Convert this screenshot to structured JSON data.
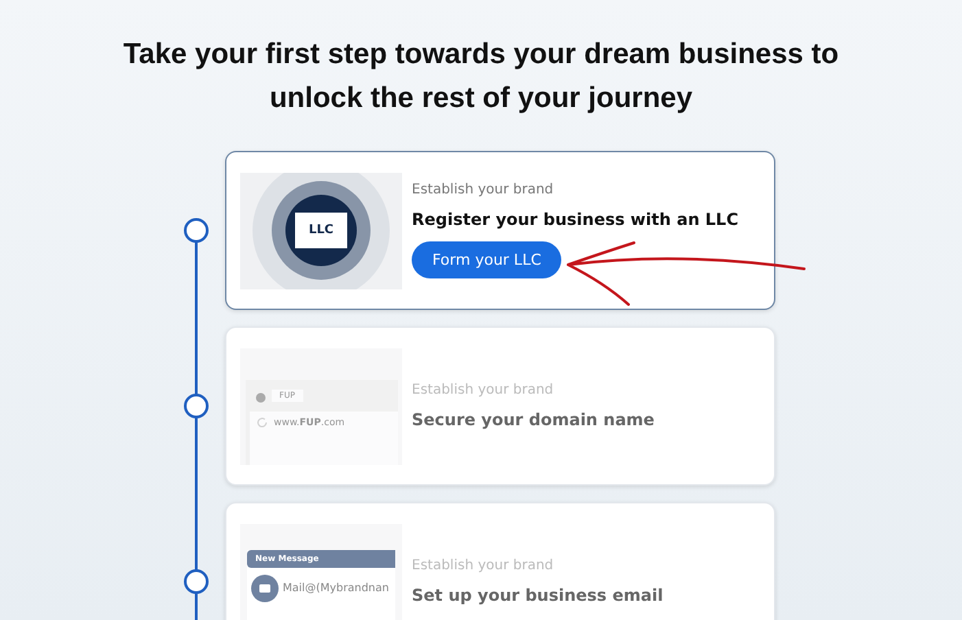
{
  "heading": "Take your first step towards your dream business to unlock the rest of your journey",
  "steps": [
    {
      "kind": "llc",
      "selected": true,
      "eyebrow": "Establish your brand",
      "title": "Register your business with an LLC",
      "art_label": "LLC",
      "button": "Form your LLC"
    },
    {
      "kind": "domain",
      "selected": false,
      "eyebrow": "Establish your brand",
      "title": "Secure your domain name",
      "art_tab": "FUP",
      "art_url": "www.**FUP**.com"
    },
    {
      "kind": "email",
      "selected": false,
      "eyebrow": "Establish your brand",
      "title": "Set up your business email",
      "art_header": "New Message",
      "art_address": "Mail@(Mybrandnan"
    }
  ]
}
